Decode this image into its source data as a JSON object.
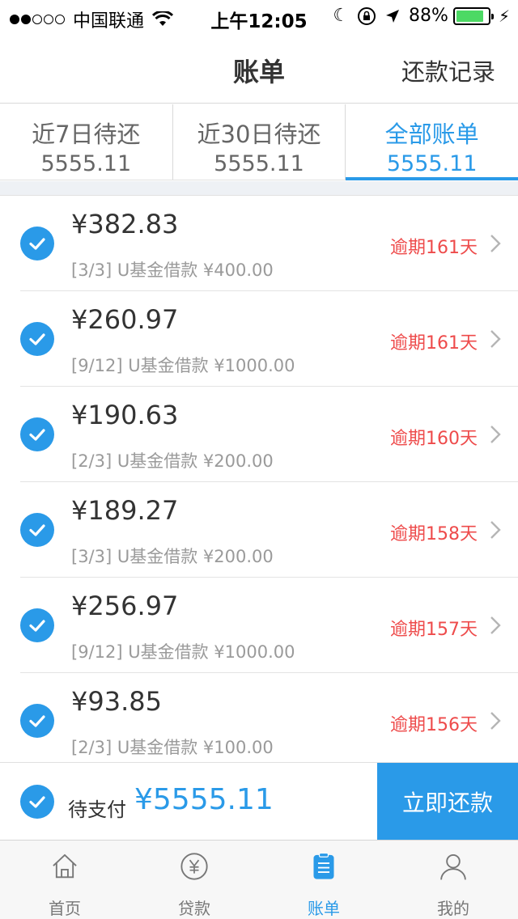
{
  "status_bar": {
    "carrier": "中国联通",
    "time": "上午12:05",
    "battery_percent": "88%",
    "battery_level": 0.88,
    "icons": [
      "signal-dots-icon",
      "wifi-icon",
      "moon-icon",
      "rotation-lock-icon",
      "location-arrow-icon",
      "battery-icon",
      "charging-bolt-icon"
    ]
  },
  "nav": {
    "title": "账单",
    "right_action": "还款记录"
  },
  "tabs": [
    {
      "label": "近7日待还",
      "amount": "5555.11",
      "active": false
    },
    {
      "label": "近30日待还",
      "amount": "5555.11",
      "active": false
    },
    {
      "label": "全部账单",
      "amount": "5555.11",
      "active": true
    }
  ],
  "bills": [
    {
      "amount": "¥382.83",
      "desc": "[3/3] U基金借款 ¥400.00",
      "overdue": "逾期161天",
      "checked": true
    },
    {
      "amount": "¥260.97",
      "desc": "[9/12] U基金借款 ¥1000.00",
      "overdue": "逾期161天",
      "checked": true
    },
    {
      "amount": "¥190.63",
      "desc": "[2/3] U基金借款 ¥200.00",
      "overdue": "逾期160天",
      "checked": true
    },
    {
      "amount": "¥189.27",
      "desc": "[3/3] U基金借款 ¥200.00",
      "overdue": "逾期158天",
      "checked": true
    },
    {
      "amount": "¥256.97",
      "desc": "[9/12] U基金借款 ¥1000.00",
      "overdue": "逾期157天",
      "checked": true
    },
    {
      "amount": "¥93.85",
      "desc": "[2/3] U基金借款 ¥100.00",
      "overdue": "逾期156天",
      "checked": true
    }
  ],
  "pay": {
    "label": "待支付",
    "amount": "¥5555.11",
    "button": "立即还款"
  },
  "tabbar": [
    {
      "label": "首页",
      "icon": "home-icon",
      "active": false
    },
    {
      "label": "贷款",
      "icon": "yuan-coin-icon",
      "active": false
    },
    {
      "label": "账单",
      "icon": "bill-clipboard-icon",
      "active": true
    },
    {
      "label": "我的",
      "icon": "user-icon",
      "active": false
    }
  ],
  "colors": {
    "accent": "#2a9ae8",
    "overdue": "#ee4b4b",
    "battery": "#4cd964"
  }
}
